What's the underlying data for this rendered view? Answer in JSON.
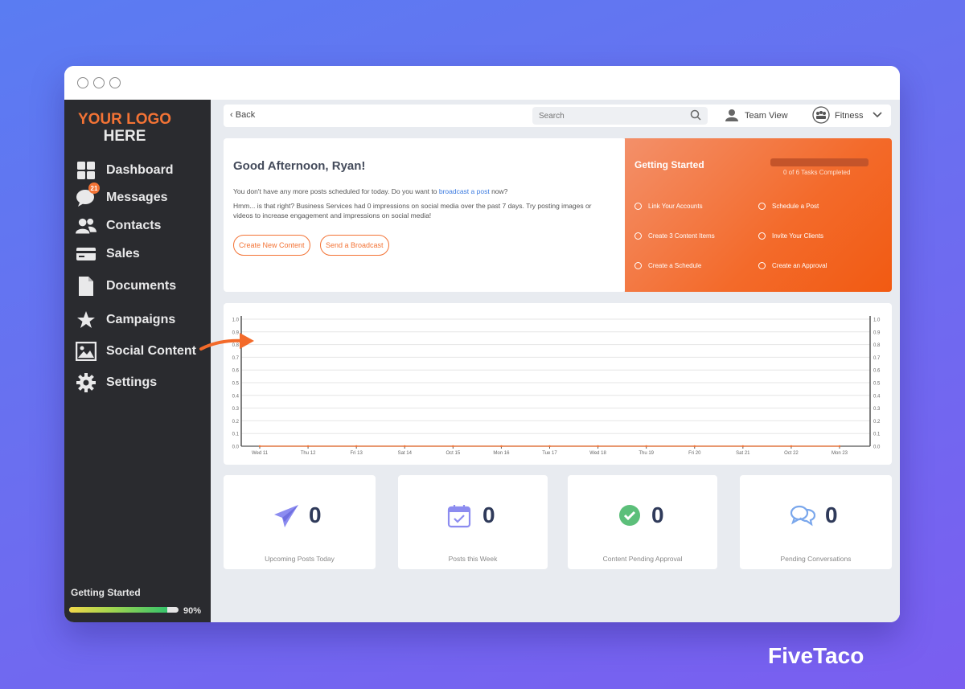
{
  "sidebar": {
    "logo_line1": "YOUR LOGO",
    "logo_line2": "HERE",
    "items": [
      {
        "label": "Dashboard",
        "icon": "grid-icon"
      },
      {
        "label": "Messages",
        "icon": "chat-icon",
        "badge": "21"
      },
      {
        "label": "Contacts",
        "icon": "people-icon"
      },
      {
        "label": "Sales",
        "icon": "card-icon"
      },
      {
        "label": "Documents",
        "icon": "document-icon"
      },
      {
        "label": "Campaigns",
        "icon": "star-icon"
      },
      {
        "label": "Social Content",
        "icon": "image-icon"
      },
      {
        "label": "Settings",
        "icon": "gear-icon"
      }
    ],
    "getting_started_label": "Getting Started",
    "getting_started_pct": "90%",
    "getting_started_value": 0.9
  },
  "topbar": {
    "back_label": "Back",
    "search_placeholder": "Search",
    "team_view_label": "Team View",
    "account_label": "Fitness"
  },
  "greeting": {
    "title": "Good Afternoon, Ryan!",
    "line1_before": "You don't have any more posts scheduled for today. Do you want to ",
    "line1_link": "broadcast a post",
    "line1_after": " now?",
    "line2": "Hmm... is that right? Business Services had 0 impressions on social media over the past 7 days. Try posting images or videos to increase engagement and impressions on social media!",
    "button_create": "Create New Content",
    "button_broadcast": "Send a Broadcast"
  },
  "getting_started": {
    "title": "Getting Started",
    "count_text": "0 of 6 Tasks Completed",
    "tasks": [
      "Link Your Accounts",
      "Schedule a Post",
      "Create 3 Content Items",
      "Invite Your Clients",
      "Create a Schedule",
      "Create an Approval"
    ]
  },
  "chart_data": {
    "type": "line",
    "categories": [
      "Wed 11",
      "Thu 12",
      "Fri 13",
      "Sat 14",
      "Oct 15",
      "Mon 16",
      "Tue 17",
      "Wed 18",
      "Thu 19",
      "Fri 20",
      "Sat 21",
      "Oct 22",
      "Mon 23"
    ],
    "series": [
      {
        "values": [
          0,
          0,
          0,
          0,
          0,
          0,
          0,
          0,
          0,
          0,
          0,
          0,
          0
        ]
      }
    ],
    "yticks": [
      "0.0",
      "0.1",
      "0.2",
      "0.3",
      "0.4",
      "0.5",
      "0.6",
      "0.7",
      "0.8",
      "0.9",
      "1.0"
    ],
    "ylim": [
      0,
      1.0
    ],
    "grid": true
  },
  "stats": [
    {
      "value": "0",
      "label": "Upcoming Posts Today",
      "icon": "paper-plane-icon"
    },
    {
      "value": "0",
      "label": "Posts this Week",
      "icon": "calendar-check-icon"
    },
    {
      "value": "0",
      "label": "Content Pending Approval",
      "icon": "check-circle-icon"
    },
    {
      "value": "0",
      "label": "Pending Conversations",
      "icon": "conversation-icon"
    }
  ],
  "brand": "FiveTaco",
  "colors": {
    "accent": "#f37335",
    "sidebar": "#2a2b2f",
    "background": "#6a6ff0"
  }
}
